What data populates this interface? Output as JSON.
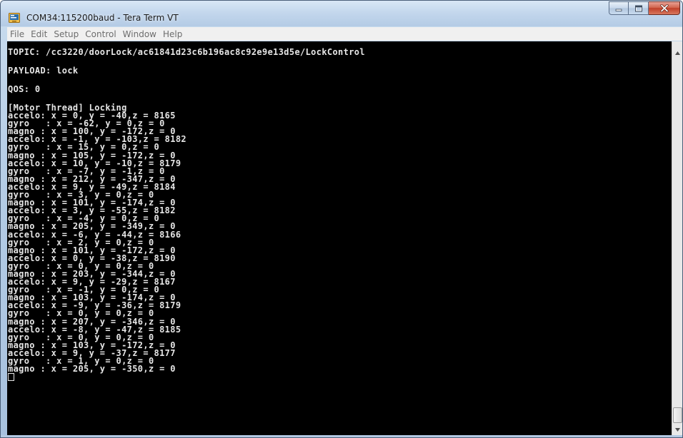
{
  "window": {
    "title": "COM34:115200baud - Tera Term VT",
    "icon": "tera-term-app-icon",
    "buttons": {
      "minimize_icon": "minimize-icon",
      "maximize_icon": "maximize-icon",
      "close_icon": "close-icon"
    },
    "accent_color": "#b4cbe5",
    "close_color": "#c0402a"
  },
  "menu": {
    "items": [
      {
        "label": "File"
      },
      {
        "label": "Edit"
      },
      {
        "label": "Setup"
      },
      {
        "label": "Control"
      },
      {
        "label": "Window"
      },
      {
        "label": "Help"
      }
    ]
  },
  "terminal": {
    "background": "#000000",
    "foreground": "#e6e6e6",
    "lines": [
      "TOPIC: /cc3220/doorLock/ac61841d23c6b196ac8c92e9e13d5e/LockControl",
      "PAYLOAD: lock",
      "QOS: 0",
      "[Motor Thread] Locking",
      "accelo: x = 0, y = -40,z = 8165",
      "gyro   : x = -62, y = 0,z = 0",
      "magno : x = 100, y = -172,z = 0",
      "accelo: x = -1, y = -103,z = 8182",
      "gyro   : x = 15, y = 0,z = 0",
      "magno : x = 105, y = -172,z = 0",
      "accelo: x = 10, y = -10,z = 8179",
      "gyro   : x = -7, y = -1,z = 0",
      "magno : x = 212, y = -347,z = 0",
      "accelo: x = 9, y = -49,z = 8184",
      "gyro   : x = 3, y = 0,z = 0",
      "magno : x = 101, y = -174,z = 0",
      "accelo: x = 3, y = -55,z = 8182",
      "gyro   : x = -4, y = 0,z = 0",
      "magno : x = 205, y = -349,z = 0",
      "accelo: x = -6, y = -44,z = 8166",
      "gyro   : x = 2, y = 0,z = 0",
      "magno : x = 101, y = -172,z = 0",
      "accelo: x = 0, y = -38,z = 8190",
      "gyro   : x = 0, y = 0,z = 0",
      "magno : x = 203, y = -344,z = 0",
      "accelo: x = 9, y = -29,z = 8167",
      "gyro   : x = -1, y = 0,z = 0",
      "magno : x = 103, y = -174,z = 0",
      "accelo: x = -9, y = -36,z = 8179",
      "gyro   : x = 0, y = 0,z = 0",
      "magno : x = 207, y = -346,z = 0",
      "accelo: x = -8, y = -47,z = 8185",
      "gyro   : x = 0, y = 0,z = 0",
      "magno : x = 103, y = -172,z = 0",
      "accelo: x = 9, y = -37,z = 8177",
      "gyro   : x = 1, y = 0,z = 0",
      "magno : x = 205, y = -350,z = 0"
    ]
  },
  "scrollbar": {
    "up_icon": "scroll-up-arrow-icon",
    "down_icon": "scroll-down-arrow-icon",
    "position_fraction": 0.97
  }
}
